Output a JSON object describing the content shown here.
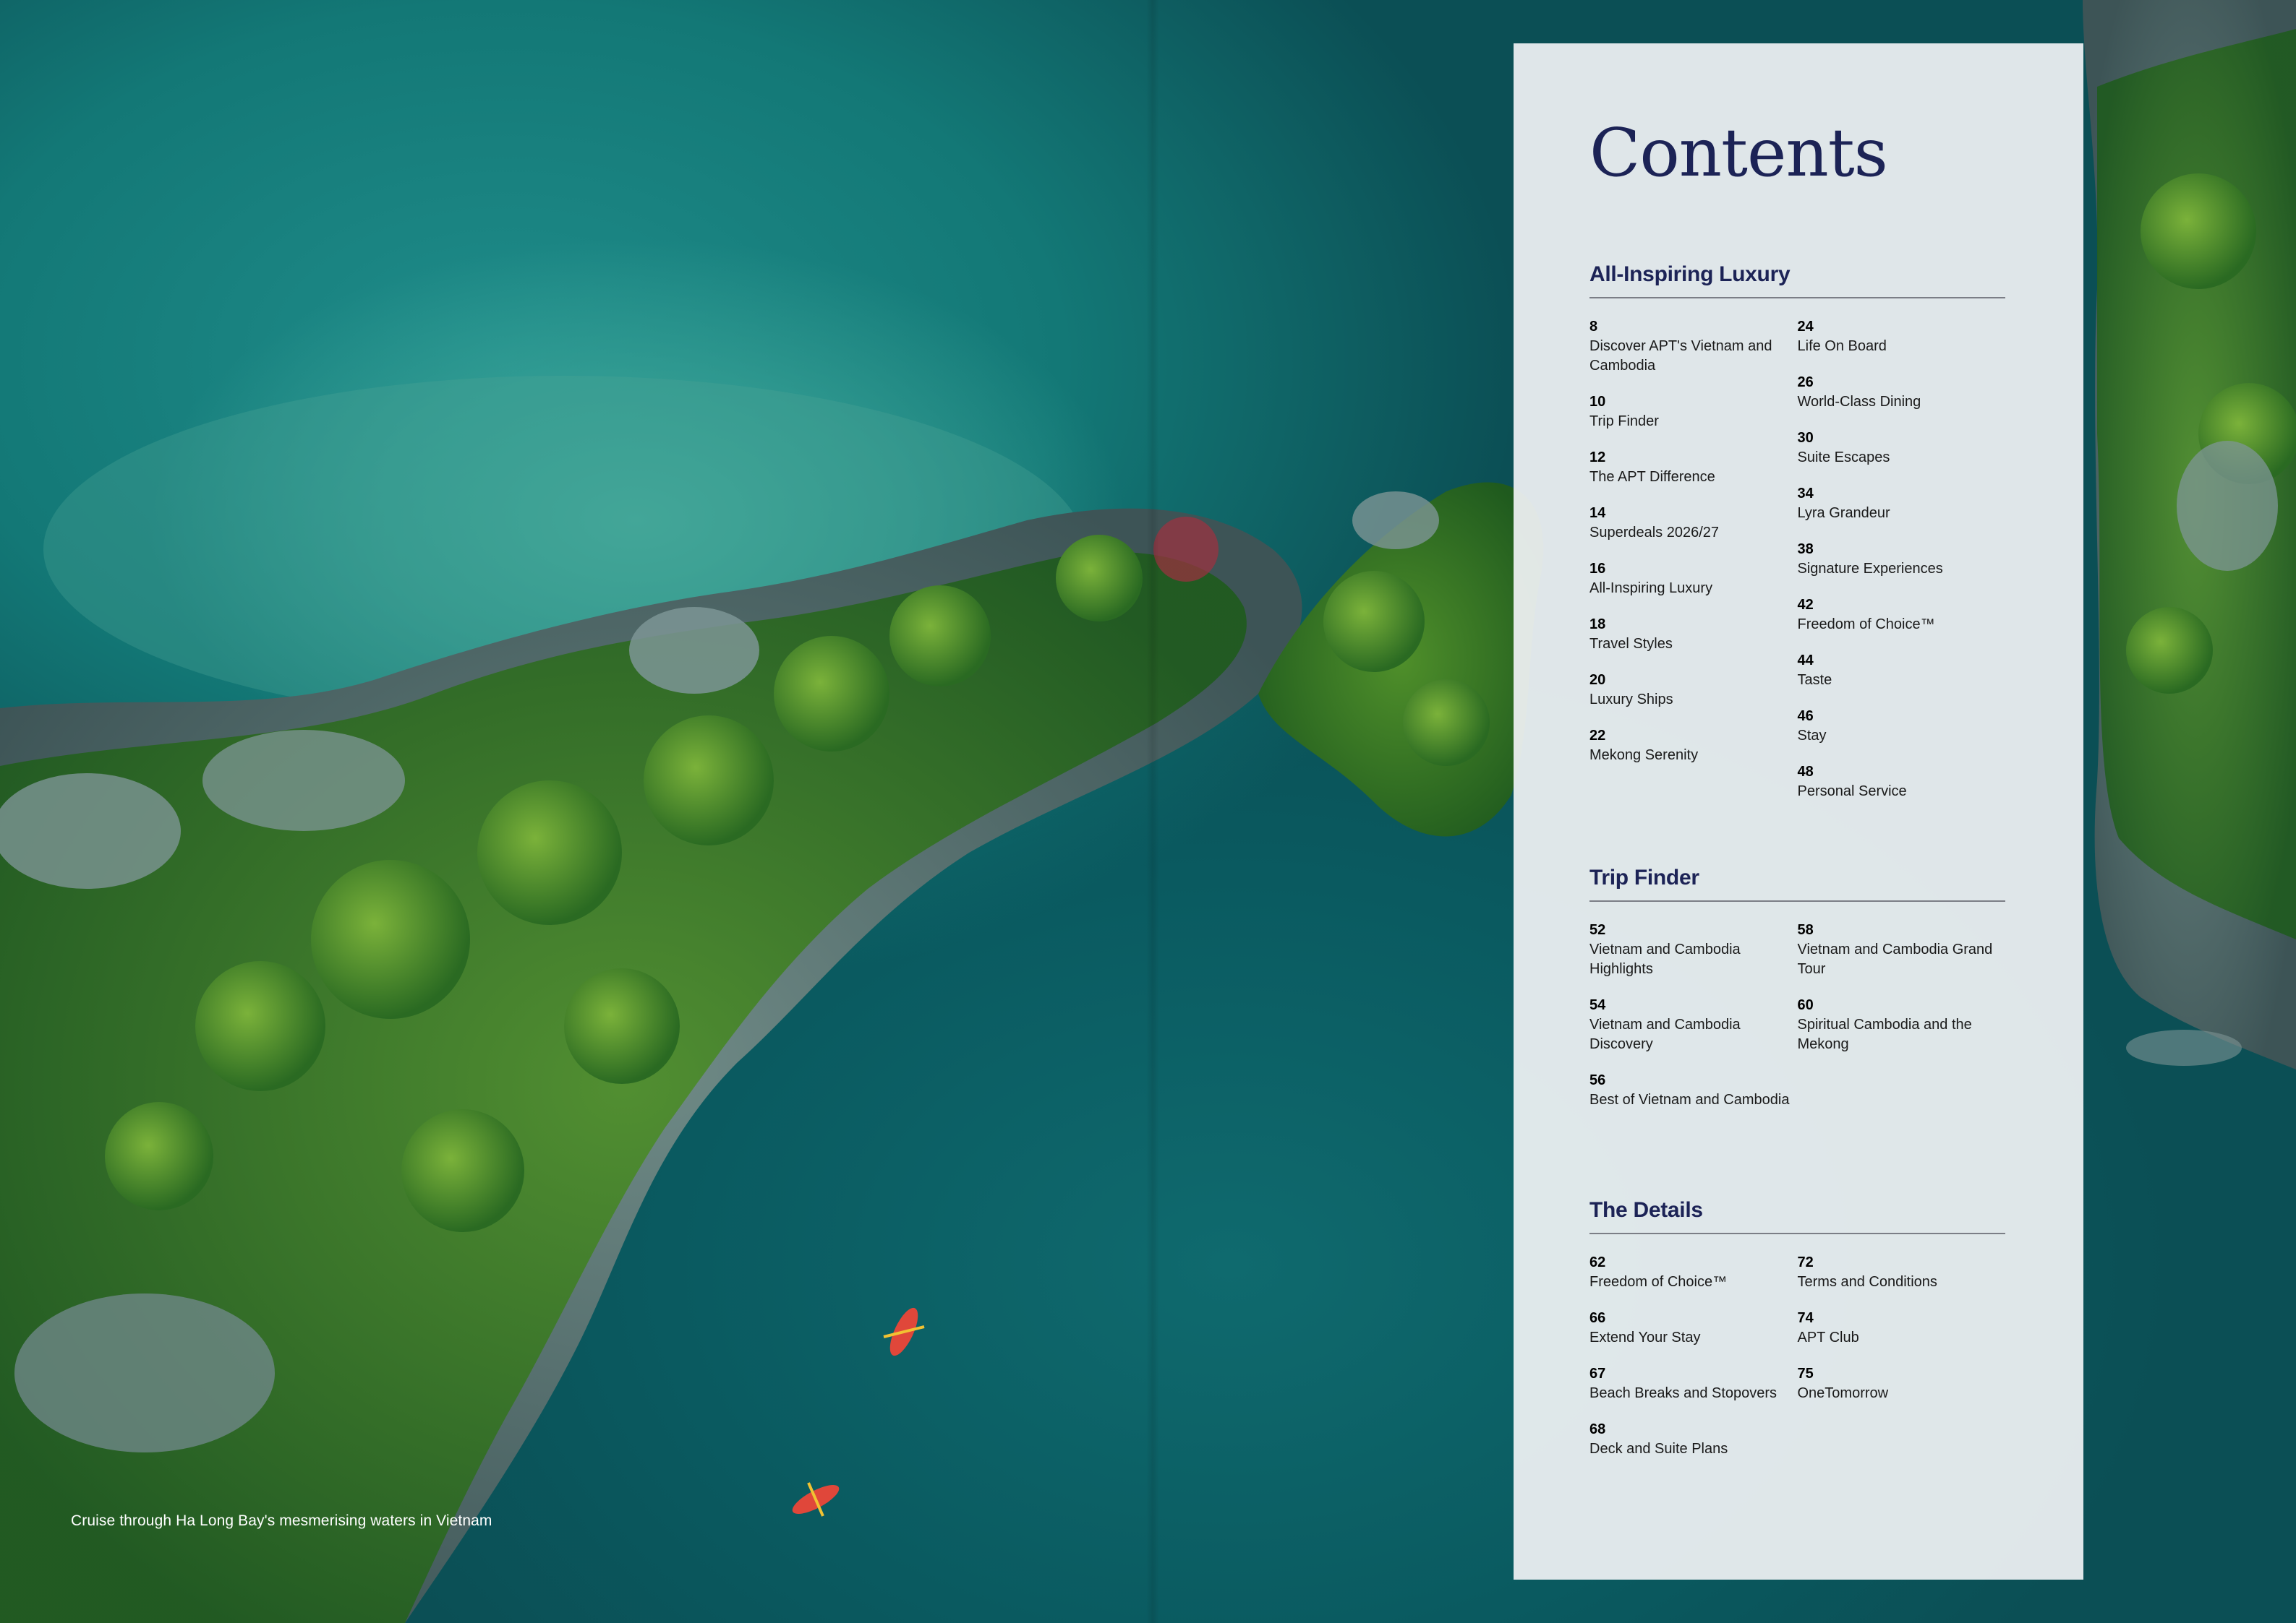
{
  "caption": "Cruise through Ha Long Bay's mesmerising waters in Vietnam",
  "contents": {
    "title": "Contents",
    "sections": [
      {
        "heading": "All-Inspiring Luxury",
        "columns": [
          [
            {
              "page": "8",
              "title": "Discover APT's Vietnam and Cambodia"
            },
            {
              "page": "10",
              "title": "Trip Finder"
            },
            {
              "page": "12",
              "title": "The APT Difference"
            },
            {
              "page": "14",
              "title": "Superdeals 2026/27"
            },
            {
              "page": "16",
              "title": "All-Inspiring Luxury"
            },
            {
              "page": "18",
              "title": "Travel Styles"
            },
            {
              "page": "20",
              "title": "Luxury Ships"
            },
            {
              "page": "22",
              "title": "Mekong Serenity"
            }
          ],
          [
            {
              "page": "24",
              "title": "Life On Board"
            },
            {
              "page": "26",
              "title": "World-Class Dining"
            },
            {
              "page": "30",
              "title": "Suite Escapes"
            },
            {
              "page": "34",
              "title": "Lyra Grandeur"
            },
            {
              "page": "38",
              "title": "Signature Experiences"
            },
            {
              "page": "42",
              "title": "Freedom of Choice™"
            },
            {
              "page": "44",
              "title": "Taste"
            },
            {
              "page": "46",
              "title": "Stay"
            },
            {
              "page": "48",
              "title": "Personal Service"
            }
          ]
        ]
      },
      {
        "heading": "Trip Finder",
        "columns": [
          [
            {
              "page": "52",
              "title": "Vietnam and Cambodia Highlights"
            },
            {
              "page": "54",
              "title": "Vietnam and Cambodia Discovery"
            },
            {
              "page": "56",
              "title": "Best of Vietnam and Cambodia"
            }
          ],
          [
            {
              "page": "58",
              "title": "Vietnam and Cambodia Grand Tour"
            },
            {
              "page": "60",
              "title": "Spiritual Cambodia and the Mekong"
            }
          ]
        ]
      },
      {
        "heading": "The Details",
        "columns": [
          [
            {
              "page": "62",
              "title": "Freedom of Choice™"
            },
            {
              "page": "66",
              "title": "Extend Your Stay"
            },
            {
              "page": "67",
              "title": "Beach Breaks and Stopovers"
            },
            {
              "page": "68",
              "title": "Deck and Suite Plans"
            }
          ],
          [
            {
              "page": "72",
              "title": "Terms and Conditions"
            },
            {
              "page": "74",
              "title": "APT Club"
            },
            {
              "page": "75",
              "title": "OneTomorrow"
            }
          ]
        ]
      }
    ]
  }
}
